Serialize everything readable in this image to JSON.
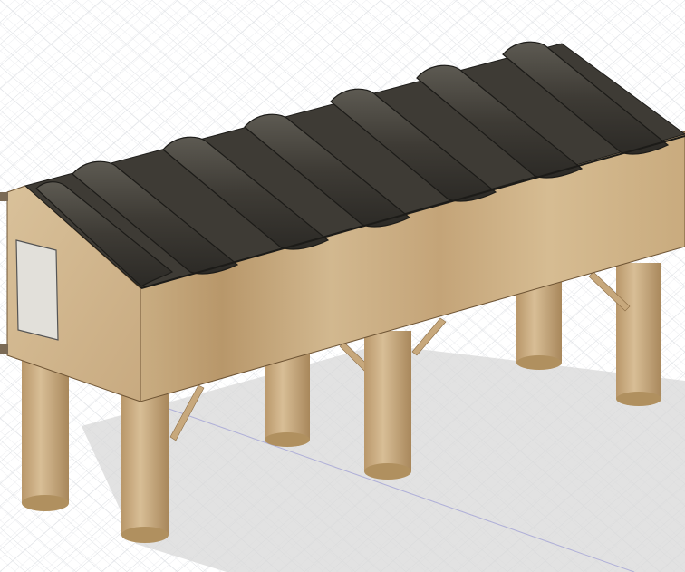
{
  "viewport": {
    "background": "#ffffff",
    "grid_minor_color": "#dcdfe3",
    "grid_major_color": "#c4c8ce",
    "axis_color": "#3a3ad6"
  },
  "model": {
    "wood_light": "#d6bc92",
    "wood_mid": "#c2a275",
    "wood_dark": "#a8875b",
    "roof_color": "#3e3b35",
    "roof_highlight": "#5d5a52",
    "door_color": "#e2e0da",
    "shadow_color": "#dcdcdc",
    "roof_ribs": 7,
    "posts": 6
  }
}
